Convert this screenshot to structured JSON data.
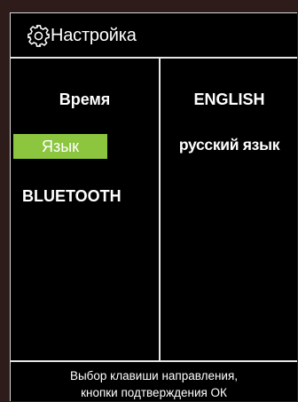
{
  "header": {
    "icon": "gear-icon",
    "title": "Настройка"
  },
  "menu": {
    "items": [
      {
        "label": "Время",
        "selected": false
      },
      {
        "label": "Язык",
        "selected": true
      },
      {
        "label": "BLUETOOTH",
        "selected": false
      }
    ],
    "highlight_color": "#8cc63f"
  },
  "options": {
    "items": [
      {
        "label": "ENGLISH"
      },
      {
        "label": "русский язык"
      }
    ]
  },
  "footer": {
    "line1": "Выбор клавиши направления,",
    "line2": "кнопки подтверждения ОК"
  }
}
